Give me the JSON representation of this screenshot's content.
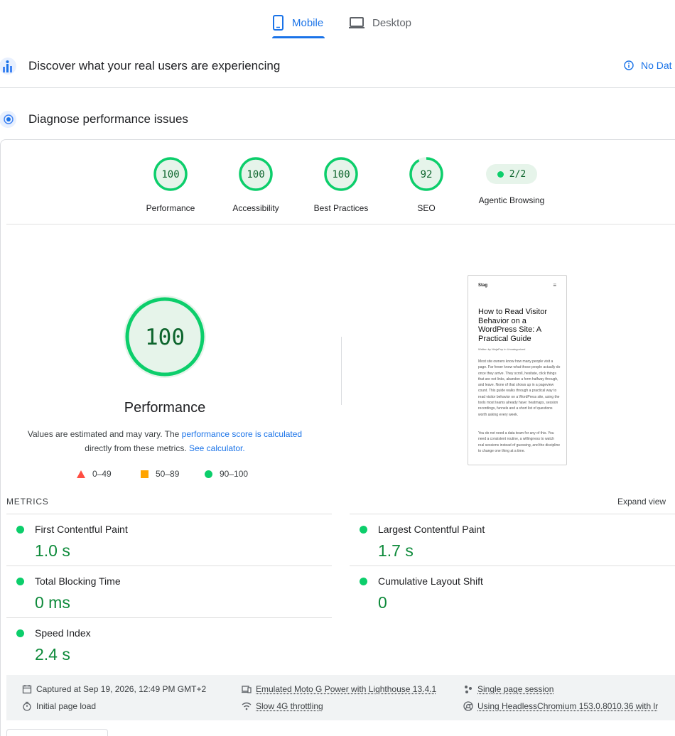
{
  "tabs": [
    {
      "label": "Mobile",
      "icon": "phone-icon",
      "active": true
    },
    {
      "label": "Desktop",
      "icon": "laptop-icon",
      "active": false
    }
  ],
  "crux": {
    "title": "Discover what your real users are experiencing",
    "no_data_label": "No Dat"
  },
  "diagnose": {
    "title": "Diagnose performance issues"
  },
  "categories": [
    {
      "label": "Performance",
      "score": "100"
    },
    {
      "label": "Accessibility",
      "score": "100"
    },
    {
      "label": "Best Practices",
      "score": "100"
    },
    {
      "label": "SEO",
      "score": "92",
      "fraction": 0.92
    },
    {
      "label": "Agentic Browsing",
      "score": "2/2"
    }
  ],
  "performance": {
    "score": "100",
    "title": "Performance",
    "desc_1": "Values are estimated and may vary. The ",
    "desc_link_1": "performance score is calculated",
    "desc_2": "directly from these metrics.",
    "desc_link_2": "See calculator."
  },
  "legend": [
    {
      "range": "0–49",
      "shape": "triangle",
      "color": "#ff4e42"
    },
    {
      "range": "50–89",
      "shape": "square",
      "color": "#ffa400"
    },
    {
      "range": "90–100",
      "shape": "circle",
      "color": "#0cce6b"
    }
  ],
  "screenshot": {
    "brand": "Stag",
    "menu": "≡",
    "heading": "How to Read Visitor Behavior on a WordPress Site: A Practical Guide",
    "byline": "Written by NinjaPup in Uncategorized",
    "para1": "Most site owners know how many people visit a page. Far fewer know what those people actually do once they arrive. They scroll, hesitate, click things that are not links, abandon a form halfway through, and leave. None of that shows up in a pageview count. This guide walks through a practical way to read visitor behavior on a WordPress site, using the tools most teams already have: heatmaps, session recordings, funnels and a short list of questions worth asking every week.",
    "para2": "You do not need a data team for any of this. You need a consistent routine, a willingness to watch real sessions instead of guessing, and the discipline to change one thing at a time."
  },
  "metrics": {
    "label": "METRICS",
    "expand_label": "Expand view",
    "items": [
      {
        "name": "First Contentful Paint",
        "value": "1.0 s"
      },
      {
        "name": "Largest Contentful Paint",
        "value": "1.7 s"
      },
      {
        "name": "Total Blocking Time",
        "value": "0 ms"
      },
      {
        "name": "Cumulative Layout Shift",
        "value": "0"
      },
      {
        "name": "Speed Index",
        "value": "2.4 s"
      }
    ]
  },
  "footer": {
    "captured": "Captured at Sep 19, 2026, 12:49 PM GMT+2",
    "initial_load": "Initial page load",
    "device": "Emulated Moto G Power with Lighthouse 13.4.1",
    "throttling": "Slow 4G throttling",
    "session": "Single page session",
    "browser": "Using HeadlessChromium 153.0.8010.36 with lr"
  },
  "colors": {
    "pass": "#0cce6b",
    "pass_text": "#0d652d",
    "link": "#1a73e8"
  }
}
